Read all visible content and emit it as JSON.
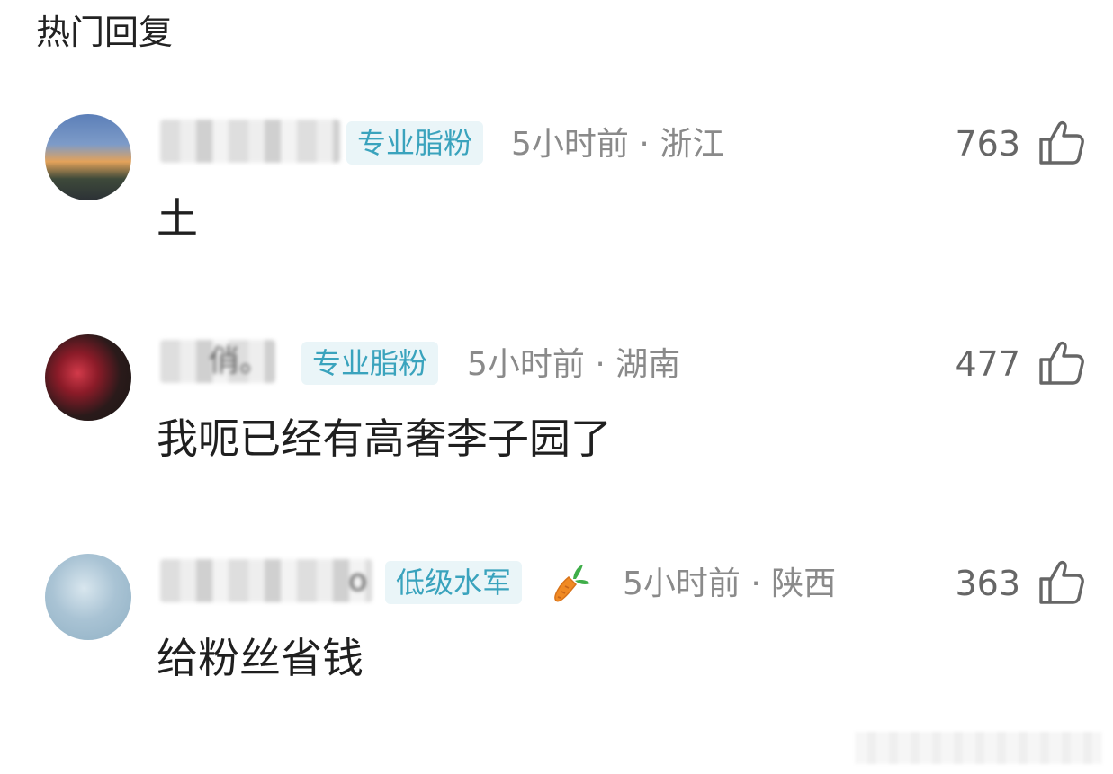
{
  "section": {
    "title": "热门回复"
  },
  "comments": [
    {
      "username_visible": "",
      "badge": "专业脂粉",
      "time": "5小时前",
      "separator": "·",
      "location": "浙江",
      "likes": "763",
      "text": "土"
    },
    {
      "username_visible": "俏。",
      "badge": "专业脂粉",
      "time": "5小时前",
      "separator": "·",
      "location": "湖南",
      "likes": "477",
      "text": "我呃已经有高奢李子园了"
    },
    {
      "username_visible": "o",
      "badge": "低级水军",
      "badge_icon": "carrot-icon",
      "time": "5小时前",
      "separator": "·",
      "location": "陕西",
      "likes": "363",
      "text": "给粉丝省钱"
    }
  ],
  "colors": {
    "badge_text": "#3aa3bd",
    "badge_bg": "#eaf5f8",
    "meta_text": "#8a8a8a",
    "like_text": "#666666"
  },
  "icons": {
    "like": "thumbs-up-icon",
    "carrot": "carrot-icon"
  }
}
